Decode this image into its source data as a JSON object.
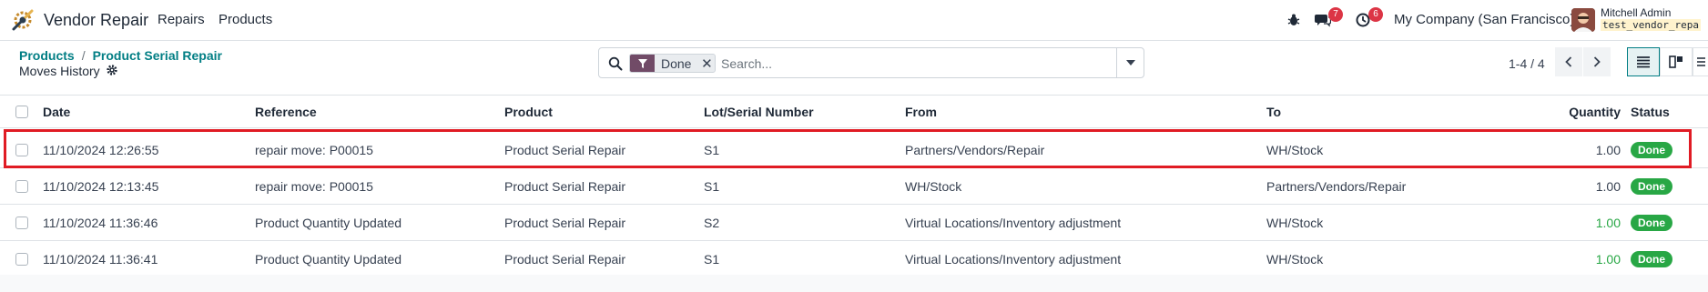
{
  "navbar": {
    "app_name": "Vendor Repair",
    "menus": [
      "Repairs",
      "Products"
    ],
    "messages_count": "7",
    "activities_count": "6",
    "company": "My Company (San Francisco)",
    "user_name": "Mitchell Admin",
    "user_db": "test_vendor_repa"
  },
  "breadcrumb": {
    "items": [
      "Products",
      "Product Serial Repair"
    ],
    "current": "Moves History"
  },
  "search": {
    "facet_value": "Done",
    "placeholder": "Search..."
  },
  "pager": {
    "value": "1-4 / 4"
  },
  "table": {
    "columns": [
      "Date",
      "Reference",
      "Product",
      "Lot/Serial Number",
      "From",
      "To",
      "Quantity",
      "Status"
    ],
    "rows": [
      {
        "date": "11/10/2024 12:26:55",
        "reference": "repair move: P00015",
        "product": "Product Serial Repair",
        "lot": "S1",
        "from": "Partners/Vendors/Repair",
        "to": "WH/Stock",
        "quantity": "1.00",
        "status": "Done"
      },
      {
        "date": "11/10/2024 12:13:45",
        "reference": "repair move: P00015",
        "product": "Product Serial Repair",
        "lot": "S1",
        "from": "WH/Stock",
        "to": "Partners/Vendors/Repair",
        "quantity": "1.00",
        "status": "Done"
      },
      {
        "date": "11/10/2024 11:36:46",
        "reference": "Product Quantity Updated",
        "product": "Product Serial Repair",
        "lot": "S2",
        "from": "Virtual Locations/Inventory adjustment",
        "to": "WH/Stock",
        "quantity": "1.00",
        "status": "Done"
      },
      {
        "date": "11/10/2024 11:36:41",
        "reference": "Product Quantity Updated",
        "product": "Product Serial Repair",
        "lot": "S1",
        "from": "Virtual Locations/Inventory adjustment",
        "to": "WH/Stock",
        "quantity": "1.00",
        "status": "Done"
      }
    ]
  },
  "colors": {
    "accent": "#017e84",
    "brand": "#714b67",
    "done": "#28a745",
    "highlight": "#e01b24"
  }
}
